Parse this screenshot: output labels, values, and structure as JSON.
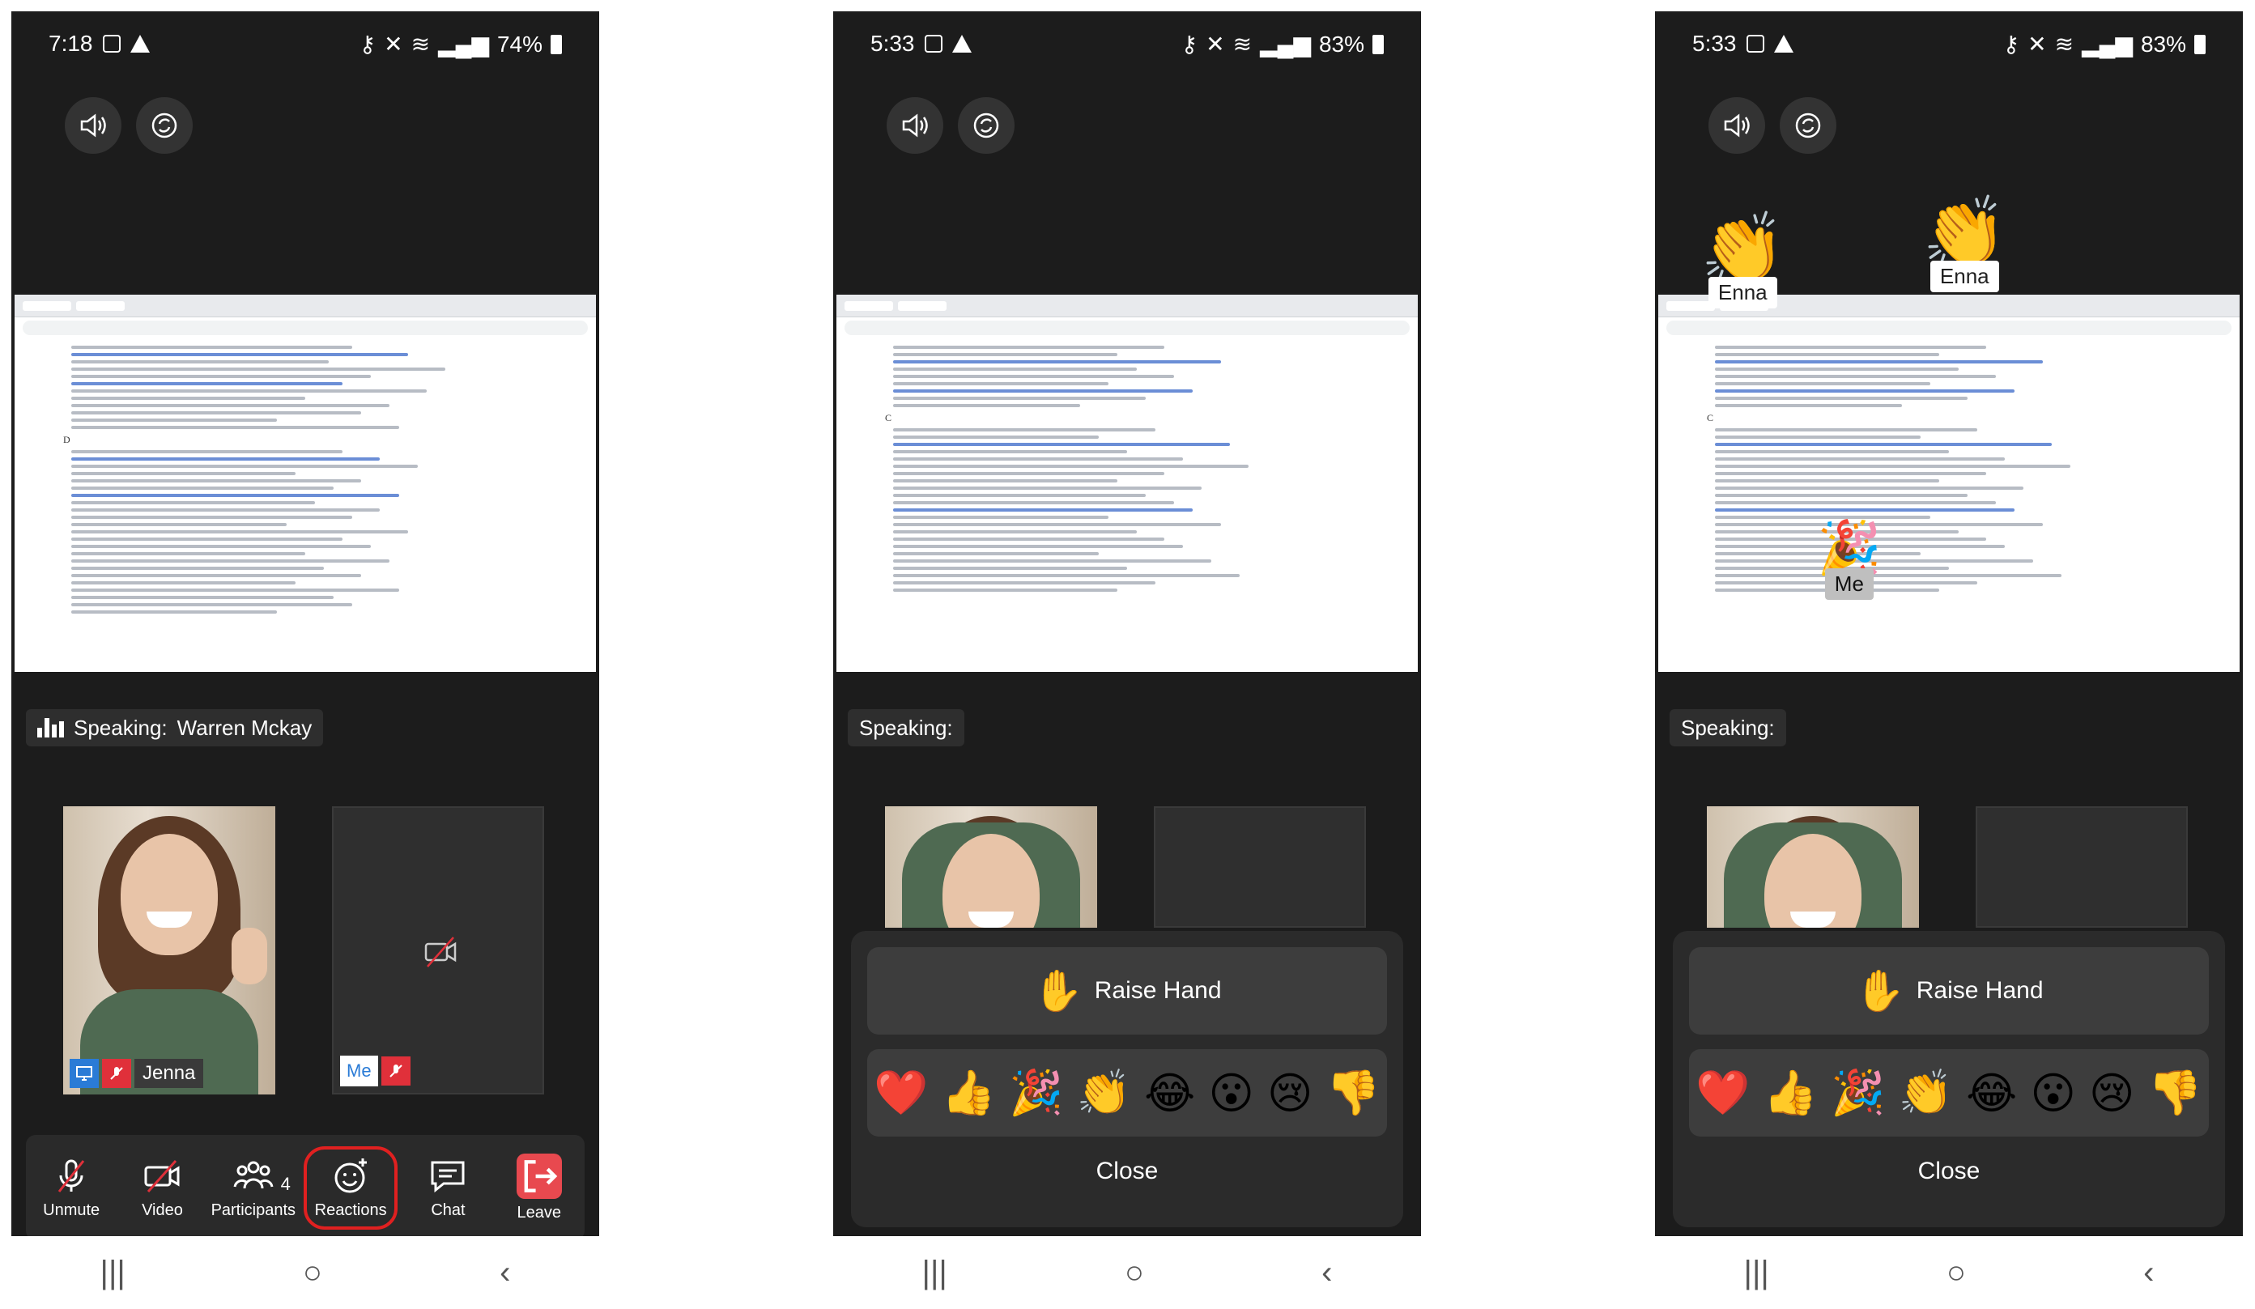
{
  "phones": [
    {
      "status": {
        "time": "7:18",
        "battery": "74%"
      },
      "speaking": {
        "label": "Speaking:",
        "name": "Warren Mckay"
      },
      "tiles": {
        "remote_name": "Jenna",
        "me_label": "Me"
      },
      "toolbar": {
        "unmute": "Unmute",
        "video": "Video",
        "participants": "Participants",
        "participants_count": "4",
        "reactions": "Reactions",
        "chat": "Chat",
        "leave": "Leave"
      }
    },
    {
      "status": {
        "time": "5:33",
        "battery": "83%"
      },
      "speaking": {
        "label": "Speaking:"
      },
      "sheet": {
        "raise_hand": "Raise Hand",
        "close": "Close",
        "emojis": [
          "❤️",
          "👍",
          "🎉",
          "👏",
          "😂",
          "😮",
          "😢",
          "👎"
        ]
      }
    },
    {
      "status": {
        "time": "5:33",
        "battery": "83%"
      },
      "speaking": {
        "label": "Speaking:"
      },
      "floating": [
        {
          "emoji": "👏",
          "name": "Enna"
        },
        {
          "emoji": "👏",
          "name": "Enna"
        },
        {
          "emoji": "🎉",
          "name": "Me"
        }
      ],
      "sheet": {
        "raise_hand": "Raise Hand",
        "close": "Close",
        "emojis": [
          "❤️",
          "👍",
          "🎉",
          "👏",
          "😂",
          "😮",
          "😢",
          "👎"
        ]
      }
    }
  ],
  "icons": {
    "raise_hand": "✋",
    "nav_recents": "|||",
    "nav_home": "○",
    "nav_back": "‹"
  },
  "colors": {
    "reactions_highlight": "#e02020",
    "leave": "#e8494f",
    "share_blue": "#2a7bd6"
  }
}
